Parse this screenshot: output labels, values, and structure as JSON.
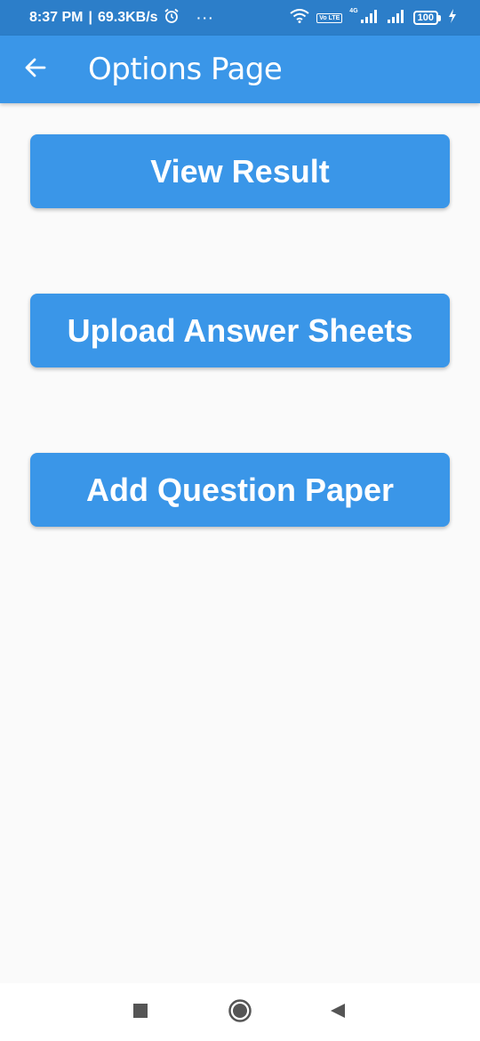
{
  "status_bar": {
    "time": "8:37 PM",
    "separator": "|",
    "speed": "69.3KB/s",
    "more": "···",
    "network_type": "4G",
    "volte": "Vo LTE",
    "battery": "100"
  },
  "app_bar": {
    "title": "Options Page",
    "back_icon": "arrow-left-icon"
  },
  "buttons": [
    {
      "label": "View Result"
    },
    {
      "label": "Upload Answer Sheets"
    },
    {
      "label": "Add Question Paper"
    }
  ],
  "nav_bar": {
    "recent_icon": "square-icon",
    "home_icon": "circle-icon",
    "back_icon": "triangle-back-icon"
  },
  "colors": {
    "status_bar": "#2c7ec9",
    "app_bar": "#3a96e8",
    "button": "#3a96e8",
    "background": "#fafafa"
  }
}
